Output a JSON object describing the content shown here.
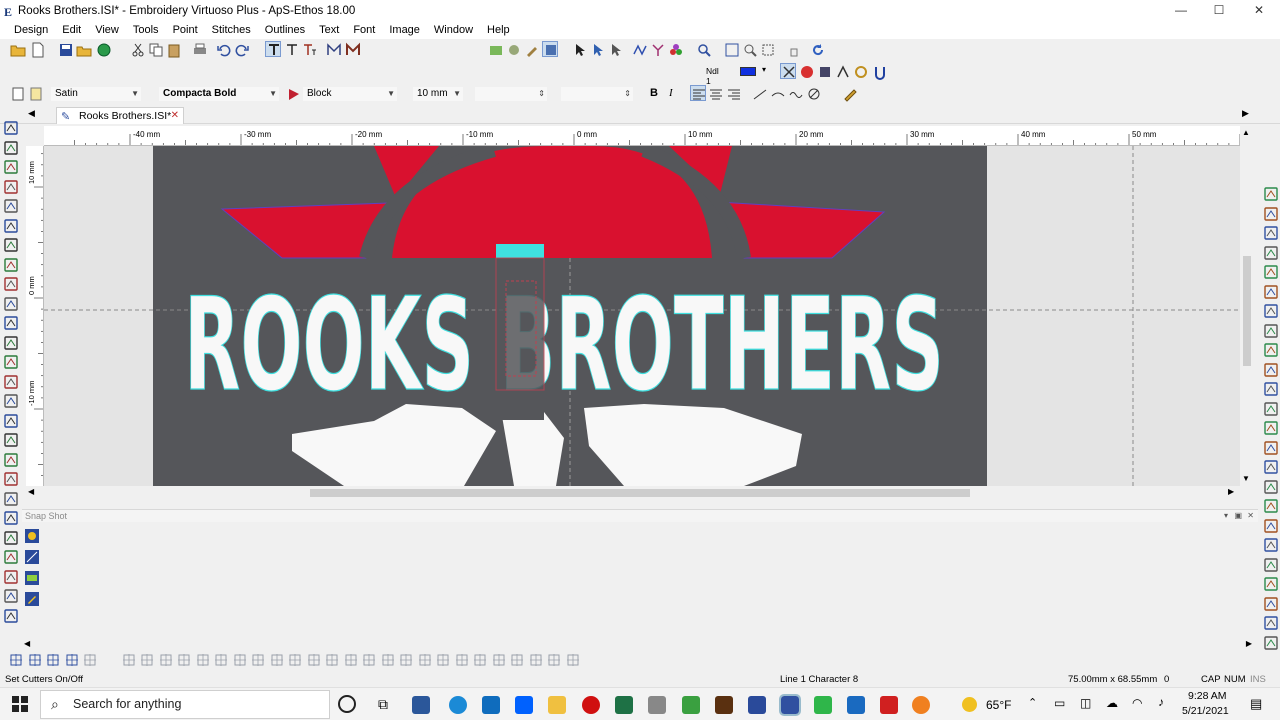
{
  "window": {
    "title": "Rooks Brothers.ISI* - Embroidery Virtuoso Plus - ApS-Ethos 18.00",
    "minimize": "—",
    "maximize": "☐",
    "close": "✕"
  },
  "menu": [
    "Design",
    "Edit",
    "View",
    "Tools",
    "Point",
    "Stitches",
    "Outlines",
    "Text",
    "Font",
    "Image",
    "Window",
    "Help"
  ],
  "toolbar2": {
    "needle_label": "Ndl 1",
    "needle_color": "#1030e0"
  },
  "toolbar3": {
    "stitch_type": "Satin",
    "font_name": "Compacta Bold",
    "style": "Block",
    "size": "10 mm",
    "bold": "B",
    "italic": "I"
  },
  "doc_tab": {
    "label": "Rooks Brothers.ISI*",
    "close": "✕"
  },
  "ruler": {
    "h_labels": [
      "-40 mm",
      "-30 mm",
      "-20 mm",
      "-10 mm",
      "0 mm",
      "10 mm",
      "20 mm",
      "30 mm",
      "40 mm",
      "50 mm"
    ],
    "v_labels": [
      "10 mm",
      "0 mm",
      "-10 mm"
    ]
  },
  "design": {
    "text": "ROOKS BROTHERS",
    "colors": {
      "red": "#d9112f",
      "gray": "#55565a",
      "white": "#f8f8f8",
      "cyan": "#3fe0e0"
    }
  },
  "snap_panel": {
    "title": "Snap Shot"
  },
  "status": {
    "left": "Set Cutters On/Off",
    "position": "Line 1 Character 8",
    "dimensions": "75.00mm x 68.55mm",
    "count": "0",
    "caps": "CAP",
    "num": "NUM",
    "ins": "INS"
  },
  "taskbar": {
    "search_placeholder": "Search for anything",
    "weather": "65°F",
    "time": "9:28 AM",
    "date": "5/21/2021"
  }
}
